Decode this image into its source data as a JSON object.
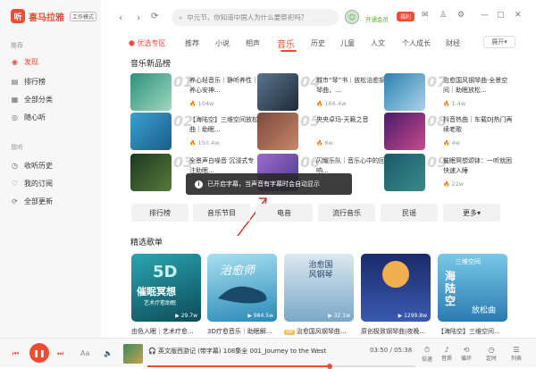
{
  "app": {
    "name": "喜马拉雅",
    "badge": "工作模式"
  },
  "sidebar": {
    "recommend_header": "推荐",
    "recommend": [
      {
        "label": "发现",
        "icon": "discover-icon",
        "active": true
      },
      {
        "label": "排行榜",
        "icon": "chart-icon"
      },
      {
        "label": "全部分类",
        "icon": "grid-icon"
      },
      {
        "label": "随心听",
        "icon": "radio-icon"
      }
    ],
    "mine_header": "我听",
    "mine": [
      {
        "label": "收听历史",
        "icon": "clock-icon"
      },
      {
        "label": "我的订阅",
        "icon": "bookmark-icon"
      },
      {
        "label": "全部更新",
        "icon": "refresh-icon"
      }
    ]
  },
  "topbar": {
    "search_placeholder": "中元节，你知道中国人为什么要祭祀吗？",
    "vip_text": "开通会员",
    "vip_button": "福利"
  },
  "tabs": {
    "items": [
      "优选专区",
      "推荐",
      "小说",
      "相声",
      "音乐",
      "历史",
      "儿童",
      "人文",
      "个人成长",
      "财经"
    ],
    "active": "音乐",
    "expand": "展开"
  },
  "music_rank": {
    "title": "音乐新品榜",
    "items": [
      {
        "rank": "01",
        "title": "养心轻音乐｜静听养性｜养心安神...",
        "plays": "104w"
      },
      {
        "rank": "02",
        "title": "【海陆空】三维空间放松曲｜助眠...",
        "plays": "150.4w"
      },
      {
        "rank": "03",
        "title": "全景声白噪音 沉浸式专注助眠...",
        "plays": ""
      },
      {
        "rank": "04",
        "title": "城市“琴”书｜放松治愈钢琴曲，...",
        "plays": "166.4w"
      },
      {
        "rank": "05",
        "title": "央央卓玛-天籁之音",
        "plays": "6w"
      },
      {
        "rank": "06",
        "title": "闪耀乐队｜音乐心中的回响...",
        "plays": ""
      },
      {
        "rank": "07",
        "title": "治愈国风钢琴曲·全景空间｜助眠放松...",
        "plays": "1.4w"
      },
      {
        "rank": "08",
        "title": "抖音热曲｜车载DJ热门再续老歌",
        "plays": "4w"
      },
      {
        "rank": "09",
        "title": "催眠冥想颂钵：一听就困 快速入睡",
        "plays": "22w"
      }
    ]
  },
  "toast": {
    "text": "已开启字幕，当声音有字幕时会自动显示"
  },
  "filters": [
    "排行榜",
    "音乐节目",
    "电音",
    "流行音乐",
    "民谣",
    "更多"
  ],
  "playlists": {
    "title": "精选歌单",
    "items": [
      {
        "overlay": "5D",
        "sub": "催眠冥想",
        "sub2": "艺术疗愈助眠",
        "count": "29.7w",
        "caption": "由色入眠｜艺术疗愈..."
      },
      {
        "overlay": "治愈师",
        "sub": "",
        "sub2": "",
        "count": "984.5w",
        "caption": "3D疗愈音乐｜助眠解..."
      },
      {
        "overlay": "治愈国风钢琴",
        "sub": "",
        "sub2": "",
        "count": "32.1w",
        "caption": "治愈国风钢琴曲..."
      },
      {
        "overlay": "",
        "sub": "",
        "sub2": "",
        "count": "1299.8w",
        "caption": "原创极致钢琴曲|夜晚..."
      },
      {
        "overlay": "海陆空",
        "sub": "三维空间",
        "sub2": "放松曲",
        "count": "",
        "caption": "【海陆空】三维空间..."
      }
    ],
    "vip_label": "VIP"
  },
  "player": {
    "track_album": "英文版西游记",
    "track_tag": "(带字幕)",
    "track_count": "108集全",
    "track_title": "001_Journey to the West",
    "time": "03:50 / 05:38",
    "progress": 0.68,
    "controls": {
      "speed_label": "倍速",
      "quality_label": "音质",
      "loop_label": "循环",
      "timer_label": "定时",
      "list_label": "列表"
    }
  },
  "colors": {
    "accent": "#f04b34"
  }
}
